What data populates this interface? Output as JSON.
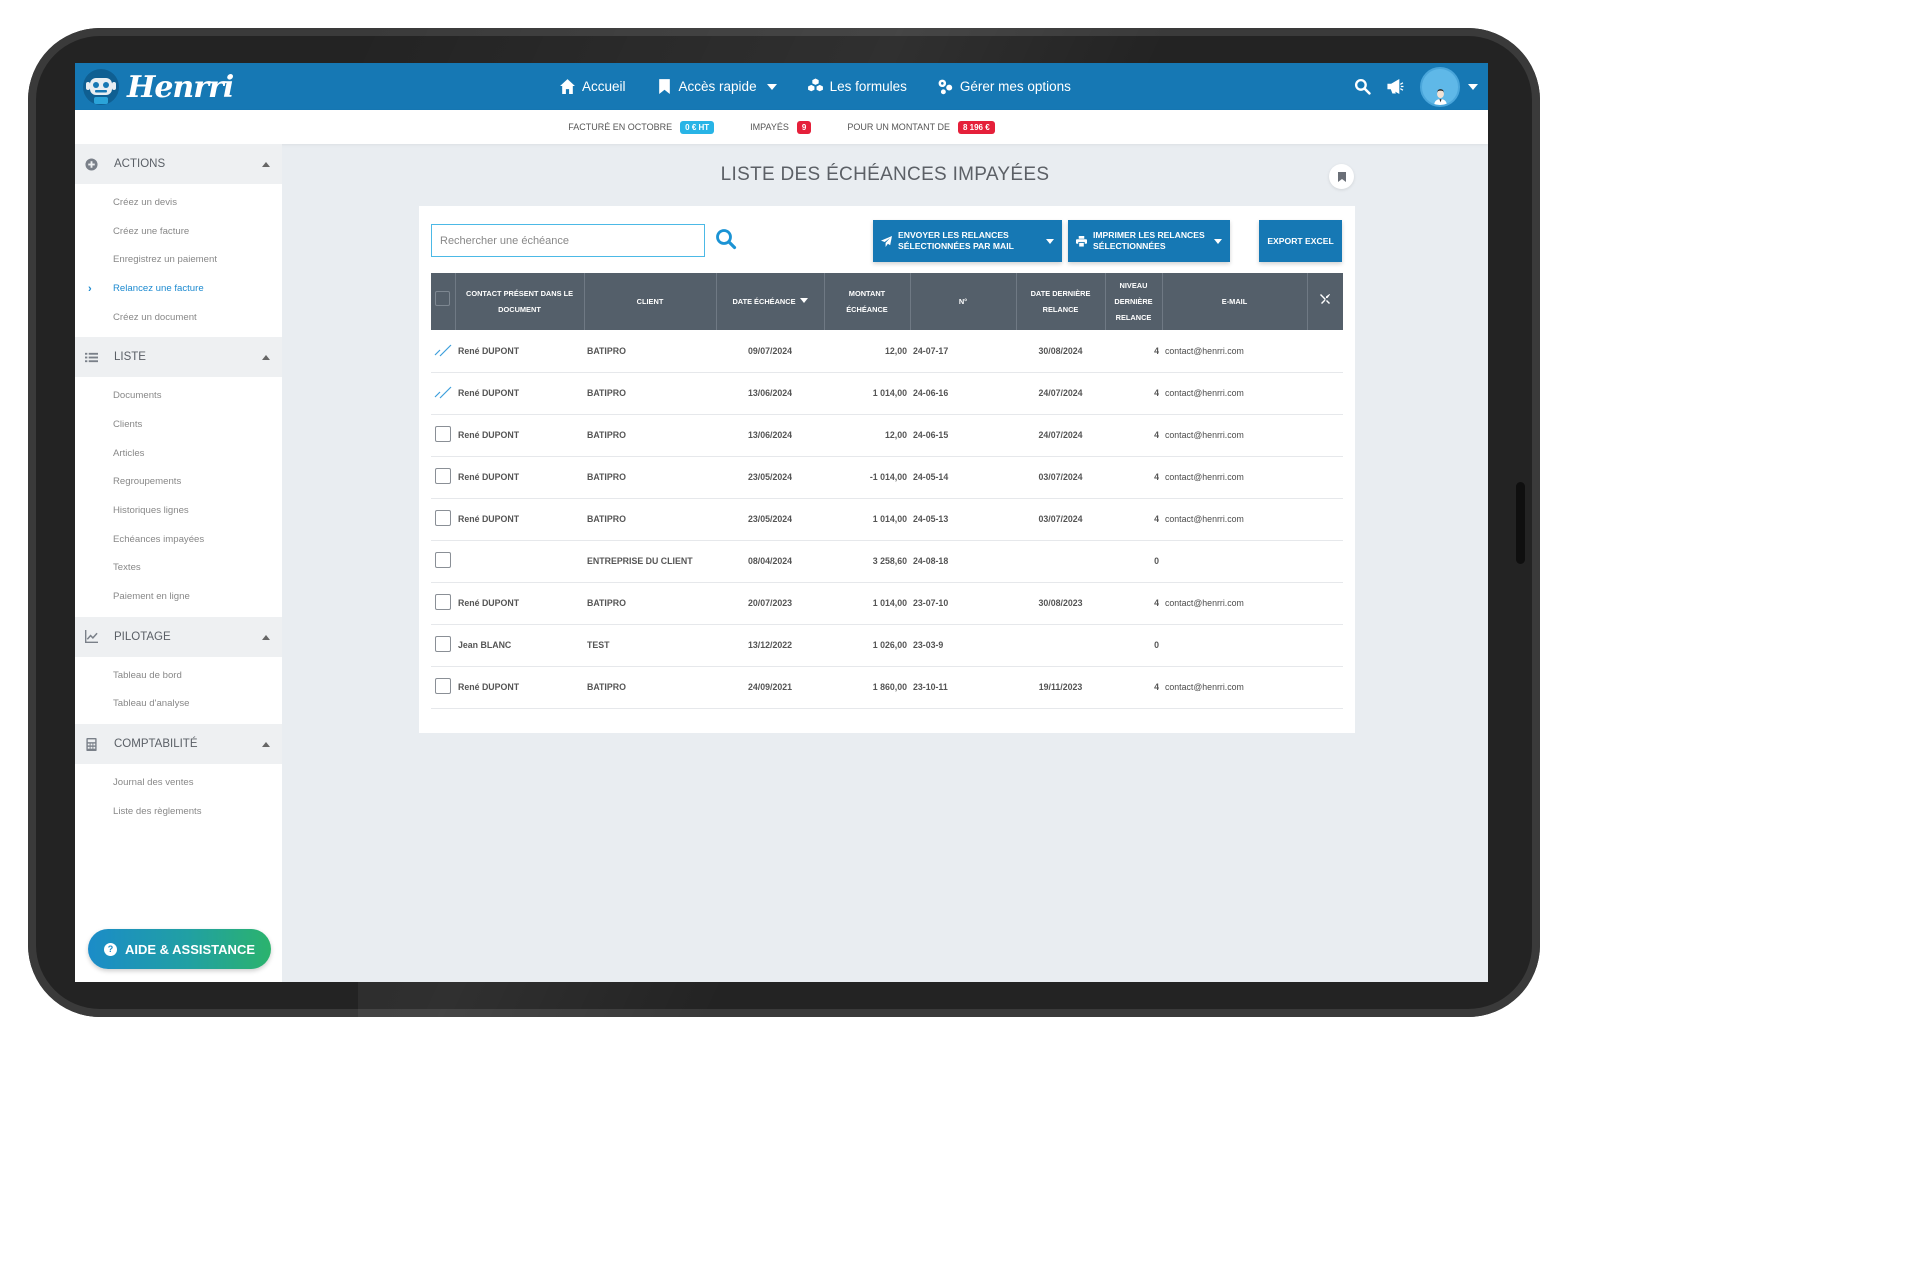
{
  "brand": {
    "logo_text": "Henrri"
  },
  "nav": {
    "items": [
      {
        "label": "Accueil",
        "icon": "home-icon"
      },
      {
        "label": "Accès rapide",
        "icon": "bookmark-icon",
        "dropdown": true
      },
      {
        "label": "Les formules",
        "icon": "cubes-icon"
      },
      {
        "label": "Gérer mes options",
        "icon": "cogs-icon"
      }
    ]
  },
  "topright": {
    "icons": [
      "search-icon",
      "megaphone-icon",
      "avatar",
      "chevron-down-icon"
    ]
  },
  "summary": {
    "facture_label": "Facturé en octobre",
    "facture_value": "0 € HT",
    "impayes_label": "Impayés",
    "impayes_value": "9",
    "montant_label": "Pour un montant de",
    "montant_value": "8 196 €"
  },
  "sidebar": {
    "sections": [
      {
        "title": "Actions",
        "icon": "plus-circle-icon",
        "items": [
          "Créez un devis",
          "Créez une facture",
          "Enregistrez un paiement",
          "Relancez une facture",
          "Créez un document"
        ],
        "active": 3
      },
      {
        "title": "Liste",
        "icon": "list-icon",
        "items": [
          "Documents",
          "Clients",
          "Articles",
          "Regroupements",
          "Historiques lignes",
          "Echéances impayées",
          "Textes",
          "Paiement en ligne"
        ]
      },
      {
        "title": "Pilotage",
        "icon": "chart-line-icon",
        "items": [
          "Tableau de bord",
          "Tableau d'analyse"
        ]
      },
      {
        "title": "Comptabilité",
        "icon": "calculator-icon",
        "items": [
          "Journal des ventes",
          "Liste des règlements"
        ]
      }
    ],
    "help_label": "AIDE & ASSISTANCE"
  },
  "page": {
    "title": "LISTE DES ÉCHÉANCES IMPAYÉES",
    "search_placeholder": "Rechercher une échéance",
    "btn_send": "Envoyer les relances sélectionnées par mail",
    "btn_print": "Imprimer les relances sélectionnées",
    "btn_export": "Export Excel"
  },
  "table": {
    "headers": [
      "Contact présent dans le document",
      "Client",
      "Date échéance",
      "Montant échéance",
      "N°",
      "Date dernière relance",
      "Niveau dernière relance",
      "E-mail"
    ],
    "rows": [
      {
        "checked": true,
        "contact": "René DUPONT",
        "client": "BATIPRO",
        "date": "09/07/2024",
        "montant": "12,00",
        "num": "24-07-17",
        "relance": "30/08/2024",
        "niveau": "4",
        "email": "contact@henrri.com"
      },
      {
        "checked": true,
        "contact": "René DUPONT",
        "client": "BATIPRO",
        "date": "13/06/2024",
        "montant": "1 014,00",
        "num": "24-06-16",
        "relance": "24/07/2024",
        "niveau": "4",
        "email": "contact@henrri.com"
      },
      {
        "checked": false,
        "contact": "René DUPONT",
        "client": "BATIPRO",
        "date": "13/06/2024",
        "montant": "12,00",
        "num": "24-06-15",
        "relance": "24/07/2024",
        "niveau": "4",
        "email": "contact@henrri.com"
      },
      {
        "checked": false,
        "contact": "René DUPONT",
        "client": "BATIPRO",
        "date": "23/05/2024",
        "montant": "-1 014,00",
        "num": "24-05-14",
        "relance": "03/07/2024",
        "niveau": "4",
        "email": "contact@henrri.com"
      },
      {
        "checked": false,
        "contact": "René DUPONT",
        "client": "BATIPRO",
        "date": "23/05/2024",
        "montant": "1 014,00",
        "num": "24-05-13",
        "relance": "03/07/2024",
        "niveau": "4",
        "email": "contact@henrri.com"
      },
      {
        "checked": false,
        "contact": "",
        "client": "ENTREPRISE DU CLIENT",
        "date": "08/04/2024",
        "montant": "3 258,60",
        "num": "24-08-18",
        "relance": "",
        "niveau": "0",
        "email": ""
      },
      {
        "checked": false,
        "contact": "René DUPONT",
        "client": "BATIPRO",
        "date": "20/07/2023",
        "montant": "1 014,00",
        "num": "23-07-10",
        "relance": "30/08/2023",
        "niveau": "4",
        "email": "contact@henrri.com"
      },
      {
        "checked": false,
        "contact": "Jean BLANC",
        "client": "TEST",
        "date": "13/12/2022",
        "montant": "1 026,00",
        "num": "23-03-9",
        "relance": "",
        "niveau": "0",
        "email": ""
      },
      {
        "checked": false,
        "contact": "René DUPONT",
        "client": "BATIPRO",
        "date": "24/09/2021",
        "montant": "1 860,00",
        "num": "23-10-11",
        "relance": "19/11/2023",
        "niveau": "4",
        "email": "contact@henrri.com"
      }
    ]
  },
  "colors": {
    "brand_blue": "#1678b4",
    "header_gray": "#545f6a",
    "badge_red": "#e5203a",
    "badge_blue": "#28b4e6"
  }
}
